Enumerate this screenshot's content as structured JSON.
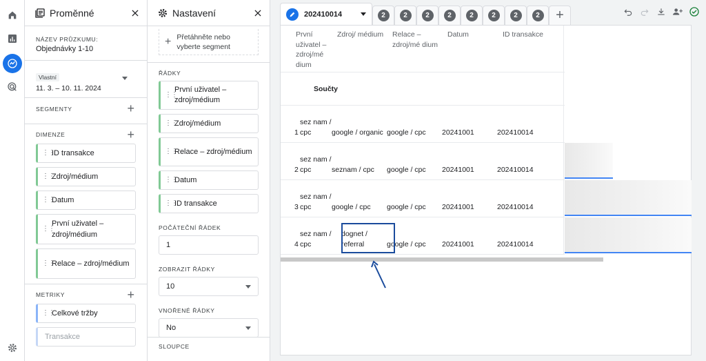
{
  "rail": {
    "items": [
      "home-icon",
      "bar-chart-icon",
      "explore-icon",
      "target-icon"
    ],
    "bottom": "gear-icon"
  },
  "variables_panel": {
    "title": "Proměnné",
    "survey_label": "NÁZEV PRŮZKUMU:",
    "survey_name": "Objednávky 1-10",
    "date_type": "Vlastní",
    "date_range": "11. 3. – 10. 11. 2024",
    "segments_label": "SEGMENTY",
    "dimensions_label": "DIMENZE",
    "dimensions": [
      "ID transakce",
      "Zdroj/médium",
      "Datum",
      "První uživatel – zdroj/médium",
      "Relace – zdroj/médium"
    ],
    "metrics_label": "METRIKY",
    "metrics": [
      "Celkové tržby",
      "Transakce"
    ]
  },
  "settings_panel": {
    "title": "Nastavení",
    "segment_drop": "Přetáhněte nebo vyberte segment",
    "rows_label": "ŘÁDKY",
    "rows": [
      "První uživatel – zdroj/médium",
      "Zdroj/médium",
      "Relace – zdroj/médium",
      "Datum",
      "ID transakce"
    ],
    "start_row_label": "POČÁTEČNÍ ŘÁDEK",
    "start_row_value": "1",
    "show_rows_label": "ZOBRAZIT ŘÁDKY",
    "show_rows_value": "10",
    "nested_rows_label": "VNOŘENÉ ŘÁDKY",
    "nested_rows_value": "No",
    "columns_label": "SLOUPCE"
  },
  "tabs": {
    "active_label": "202410014",
    "badge": "2",
    "count": 9
  },
  "table": {
    "headers": [
      "První uživatel – zdroj/mé dium",
      "Zdroj/ médium",
      "Relace – zdroj/mé dium",
      "Datum",
      "ID transakce"
    ],
    "totals_label": "Součty",
    "rows": [
      {
        "n": "1",
        "first": "sez nam / cpc",
        "source": "google / organic",
        "session": "google / cpc",
        "date": "20241001",
        "id": "202410014"
      },
      {
        "n": "2",
        "first": "sez nam / cpc",
        "source": "seznam / cpc",
        "session": "google / cpc",
        "date": "20241001",
        "id": "202410014"
      },
      {
        "n": "3",
        "first": "sez nam / cpc",
        "source": "google / cpc",
        "session": "google / cpc",
        "date": "20241001",
        "id": "202410014"
      },
      {
        "n": "4",
        "first": "sez nam / cpc",
        "source": "dognet / referral",
        "session": "google / cpc",
        "date": "20241001",
        "id": "202410014"
      }
    ]
  },
  "colors": {
    "accent": "#1a73e8",
    "dimension_chip": "#81c995",
    "metric_chip": "#8ab4f8",
    "highlight": "#1a4b9c"
  }
}
